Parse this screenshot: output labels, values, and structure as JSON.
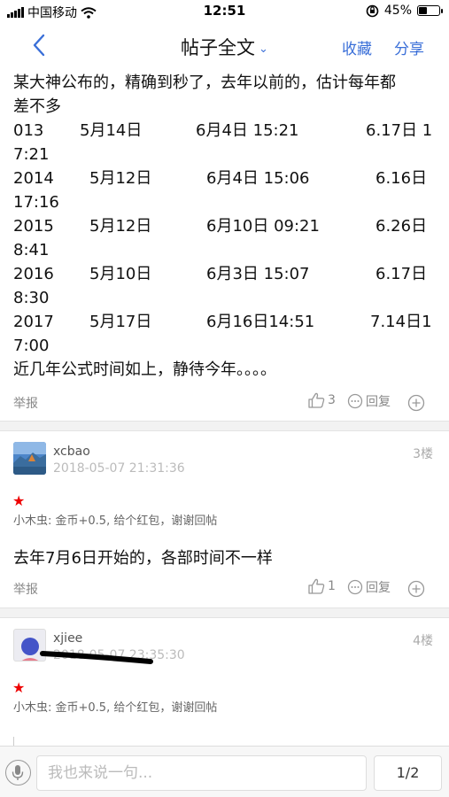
{
  "status_bar": {
    "carrier": "中国移动",
    "time": "12:51",
    "battery_text": "45%",
    "battery_level": 0.45
  },
  "nav": {
    "back_icon": "chevron-left-icon",
    "title": "帖子全文",
    "favorite_label": "收藏",
    "share_label": "分享",
    "accent_color": "#3a6fd8"
  },
  "post": {
    "intro_line1": "某大神公布的，精确到秒了，去年以前的，估计每年都",
    "intro_line2": "差不多",
    "rows": [
      {
        "a": "013",
        "b": "5月14日",
        "c": "6月4日 15:21",
        "d": "6.17日 1",
        "e": "7:21"
      },
      {
        "a": "2014",
        "b": "5月12日",
        "c": "6月4日 15:06",
        "d": "6.16日",
        "e": "17:16"
      },
      {
        "a": "2015",
        "b": "5月12日",
        "c": "6月10日 09:21",
        "d": "6.26日",
        "e": "8:41"
      },
      {
        "a": "2016",
        "b": "5月10日",
        "c": "6月3日 15:07",
        "d": "6.17日",
        "e": "8:30"
      },
      {
        "a": "2017",
        "b": "5月17日",
        "c": "6月16日14:51",
        "d": "7.14日1",
        "e": "7:00"
      }
    ],
    "closing": "近几年公式时间如上，静待今年。。。。",
    "report_label": "举报",
    "likes": "3",
    "reply_label": "回复"
  },
  "replies": [
    {
      "username": "xcbao",
      "date": "2018-05-07 21:31:36",
      "floor": "3楼",
      "star": "★",
      "reward": "小木虫: 金币+0.5, 给个红包，谢谢回帖",
      "content": "去年7月6日开始的，各部时间不一样",
      "report_label": "举报",
      "likes": "1",
      "reply_label": "回复"
    },
    {
      "username": "xjiee",
      "date": "2018-05-07 23:35:30",
      "floor": "4楼",
      "star": "★",
      "reward": "小木虫: 金币+0.5, 给个红包，谢谢回帖"
    }
  ],
  "bottom": {
    "input_placeholder": "我也来说一句...",
    "page_indicator": "1/2"
  }
}
